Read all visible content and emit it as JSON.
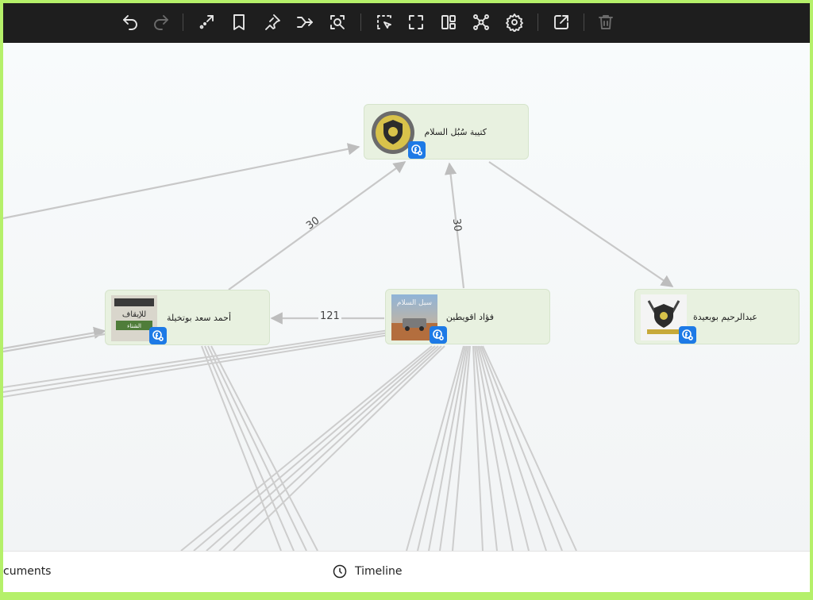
{
  "toolbar": {
    "icons": [
      "undo-icon",
      "redo-icon",
      "expand-arrows-icon",
      "bookmark-icon",
      "pin-icon",
      "merge-icon",
      "focus-search-icon",
      "select-area-icon",
      "fit-screen-icon",
      "layout-icon",
      "network-icon",
      "settings-icon",
      "export-icon",
      "delete-icon"
    ]
  },
  "nodes": {
    "center": {
      "label": "كتيبة سُبُل السلام"
    },
    "left": {
      "label": "أحمد سعد بوتخيلة",
      "thumb_text": [
        "للإيقاف",
        "الشتاء"
      ]
    },
    "middle": {
      "label": "فؤاد اقويطين",
      "thumb_text": "سبل السلام"
    },
    "right": {
      "label": "عبدالرحيم بوبعيدة"
    }
  },
  "edge_labels": {
    "left_to_center": "30",
    "middle_to_center": "30",
    "middle_to_left": "121"
  },
  "bottom_tabs": {
    "documents": "cuments",
    "timeline": "Timeline"
  },
  "colors": {
    "toolbar_bg": "#1e1e1e",
    "node_bg": "#e8f1e0",
    "badge": "#1d7ae6",
    "edge": "#c4c4c4",
    "frame_border": "#b5f06a"
  }
}
